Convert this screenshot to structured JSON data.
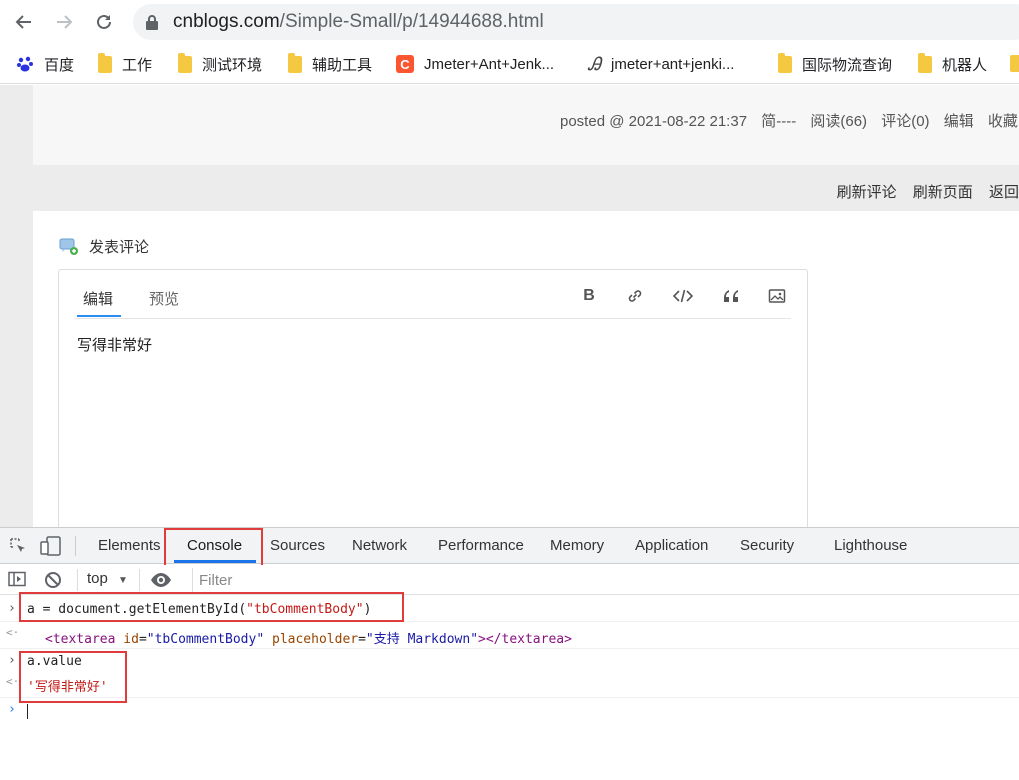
{
  "browser": {
    "url_host": "cnblogs.com",
    "url_path": "/Simple-Small/p/14944688.html"
  },
  "bookmarks": [
    {
      "label": "百度",
      "icon": "baidu-paw-icon"
    },
    {
      "label": "工作",
      "icon": "folder-icon"
    },
    {
      "label": "测试环境",
      "icon": "folder-icon"
    },
    {
      "label": "辅助工具",
      "icon": "folder-icon"
    },
    {
      "label": "Jmeter+Ant+Jenk...",
      "icon": "csdn-icon"
    },
    {
      "label": "jmeter+ant+jenki...",
      "icon": "jianshu-icon"
    },
    {
      "label": "国际物流查询",
      "icon": "folder-icon"
    },
    {
      "label": "机器人",
      "icon": "folder-icon"
    }
  ],
  "post": {
    "posted": "posted @ 2021-08-22 21:37",
    "author": "简----",
    "reads": "阅读(66)",
    "comments": "评论(0)",
    "edit": "编辑",
    "favorite": "收藏"
  },
  "refresh": {
    "refresh_comments": "刷新评论",
    "refresh_page": "刷新页面",
    "back": "返回"
  },
  "comment": {
    "title": "发表评论",
    "tab_edit": "编辑",
    "tab_preview": "预览",
    "tool_bold": "B",
    "body": "写得非常好"
  },
  "devtools": {
    "tabs": [
      "Elements",
      "Console",
      "Sources",
      "Network",
      "Performance",
      "Memory",
      "Application",
      "Security",
      "Lighthouse"
    ],
    "active_tab": "Console",
    "context": "top",
    "filter_placeholder": "Filter"
  },
  "console": {
    "cmd1_prefix": "a = document.getElementById(",
    "cmd1_arg": "\"tbCommentBody\"",
    "cmd1_suffix": ")",
    "res1_open": "<textarea",
    "res1_attr_id": "id",
    "res1_val_id": "\"tbCommentBody\"",
    "res1_attr_ph": "placeholder",
    "res1_val_ph": "\"支持 Markdown\"",
    "res1_close": "></textarea>",
    "cmd2": "a.value",
    "res2": "'写得非常好'"
  },
  "colors": {
    "highlight_box": "#e03c3c",
    "active_tab_underline": "#1a73e8",
    "editor_tab_underline": "#2d8cf0"
  }
}
